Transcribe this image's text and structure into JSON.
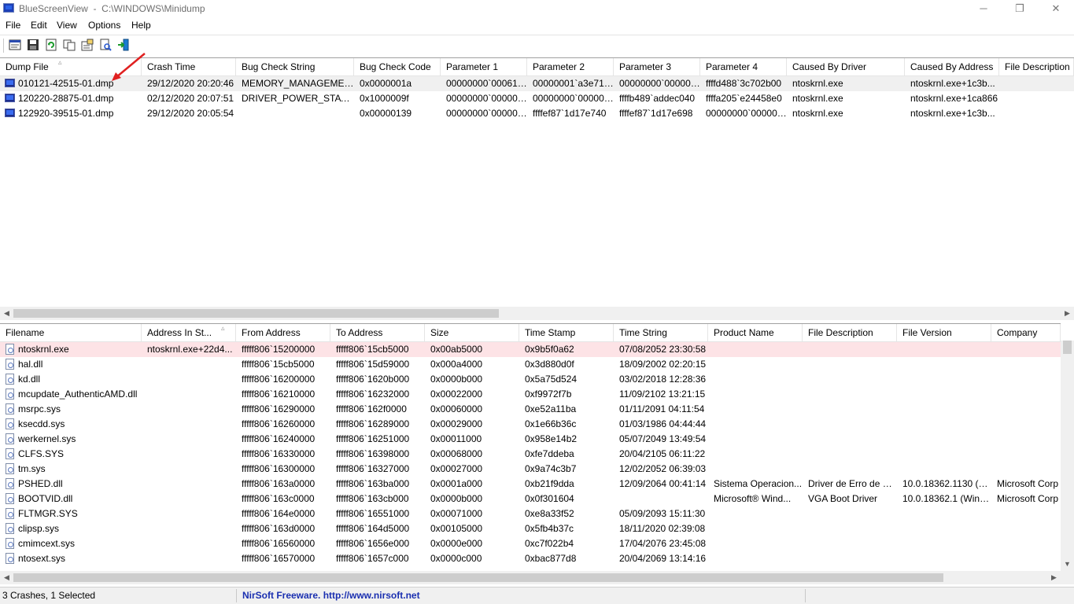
{
  "window": {
    "title": "BlueScreenView  -  C:\\WINDOWS\\Minidump",
    "minimize": "─",
    "restore": "❐",
    "close": "✕"
  },
  "menu": [
    "File",
    "Edit",
    "View",
    "Options",
    "Help"
  ],
  "toolbar": [
    "html-report-icon",
    "save-icon",
    "refresh-icon",
    "copy-icon",
    "properties-icon",
    "find-icon",
    "exit-icon"
  ],
  "dump_list": {
    "columns": [
      "Dump File",
      "Crash Time",
      "Bug Check String",
      "Bug Check Code",
      "Parameter 1",
      "Parameter 2",
      "Parameter 3",
      "Parameter 4",
      "Caused By Driver",
      "Caused By Address",
      "File Description"
    ],
    "sort_indicator": "▵",
    "rows": [
      [
        "010121-42515-01.dmp",
        "29/12/2020 20:20:46",
        "MEMORY_MANAGEMENT",
        "0x0000001a",
        "00000000`000619...",
        "00000001`a3e71fd0",
        "00000000`000000...",
        "ffffd488`3c702b00",
        "ntoskrnl.exe",
        "ntoskrnl.exe+1c3b...",
        ""
      ],
      [
        "120220-28875-01.dmp",
        "02/12/2020 20:07:51",
        "DRIVER_POWER_STATE_F...",
        "0x1000009f",
        "00000000`000000...",
        "00000000`000001...",
        "ffffb489`addec040",
        "ffffa205`e24458e0",
        "ntoskrnl.exe",
        "ntoskrnl.exe+1ca866",
        ""
      ],
      [
        "122920-39515-01.dmp",
        "29/12/2020 20:05:54",
        "",
        "0x00000139",
        "00000000`000000...",
        "ffffef87`1d17e740",
        "ffffef87`1d17e698",
        "00000000`000000...",
        "ntoskrnl.exe",
        "ntoskrnl.exe+1c3b...",
        ""
      ]
    ]
  },
  "driver_list": {
    "columns": [
      "Filename",
      "Address In St...",
      "From Address",
      "To Address",
      "Size",
      "Time Stamp",
      "Time String",
      "Product Name",
      "File Description",
      "File Version",
      "Company"
    ],
    "sort_indicator": "▵",
    "rows": [
      [
        "ntoskrnl.exe",
        "ntoskrnl.exe+22d4...",
        "fffff806`15200000",
        "fffff806`15cb5000",
        "0x00ab5000",
        "0x9b5f0a62",
        "07/08/2052 23:30:58",
        "",
        "",
        "",
        ""
      ],
      [
        "hal.dll",
        "",
        "fffff806`15cb5000",
        "fffff806`15d59000",
        "0x000a4000",
        "0x3d880d0f",
        "18/09/2002 02:20:15",
        "",
        "",
        "",
        ""
      ],
      [
        "kd.dll",
        "",
        "fffff806`16200000",
        "fffff806`1620b000",
        "0x0000b000",
        "0x5a75d524",
        "03/02/2018 12:28:36",
        "",
        "",
        "",
        ""
      ],
      [
        "mcupdate_AuthenticAMD.dll",
        "",
        "fffff806`16210000",
        "fffff806`16232000",
        "0x00022000",
        "0xf9972f7b",
        "11/09/2102 13:21:15",
        "",
        "",
        "",
        ""
      ],
      [
        "msrpc.sys",
        "",
        "fffff806`16290000",
        "fffff806`162f0000",
        "0x00060000",
        "0xe52a11ba",
        "01/11/2091 04:11:54",
        "",
        "",
        "",
        ""
      ],
      [
        "ksecdd.sys",
        "",
        "fffff806`16260000",
        "fffff806`16289000",
        "0x00029000",
        "0x1e66b36c",
        "01/03/1986 04:44:44",
        "",
        "",
        "",
        ""
      ],
      [
        "werkernel.sys",
        "",
        "fffff806`16240000",
        "fffff806`16251000",
        "0x00011000",
        "0x958e14b2",
        "05/07/2049 13:49:54",
        "",
        "",
        "",
        ""
      ],
      [
        "CLFS.SYS",
        "",
        "fffff806`16330000",
        "fffff806`16398000",
        "0x00068000",
        "0xfe7ddeba",
        "20/04/2105 06:11:22",
        "",
        "",
        "",
        ""
      ],
      [
        "tm.sys",
        "",
        "fffff806`16300000",
        "fffff806`16327000",
        "0x00027000",
        "0x9a74c3b7",
        "12/02/2052 06:39:03",
        "",
        "",
        "",
        ""
      ],
      [
        "PSHED.dll",
        "",
        "fffff806`163a0000",
        "fffff806`163ba000",
        "0x0001a000",
        "0xb21f9dda",
        "12/09/2064 00:41:14",
        "Sistema Operacion...",
        "Driver de Erro de H...",
        "10.0.18362.1130 (W...",
        "Microsoft Corp"
      ],
      [
        "BOOTVID.dll",
        "",
        "fffff806`163c0000",
        "fffff806`163cb000",
        "0x0000b000",
        "0x0f301604",
        "",
        "Microsoft® Wind...",
        "VGA Boot Driver",
        "10.0.18362.1 (WinB...",
        "Microsoft Corp"
      ],
      [
        "FLTMGR.SYS",
        "",
        "fffff806`164e0000",
        "fffff806`16551000",
        "0x00071000",
        "0xe8a33f52",
        "05/09/2093 15:11:30",
        "",
        "",
        "",
        ""
      ],
      [
        "clipsp.sys",
        "",
        "fffff806`163d0000",
        "fffff806`164d5000",
        "0x00105000",
        "0x5fb4b37c",
        "18/11/2020 02:39:08",
        "",
        "",
        "",
        ""
      ],
      [
        "cmimcext.sys",
        "",
        "fffff806`16560000",
        "fffff806`1656e000",
        "0x0000e000",
        "0xc7f022b4",
        "17/04/2076 23:45:08",
        "",
        "",
        "",
        ""
      ],
      [
        "ntosext.sys",
        "",
        "fffff806`16570000",
        "fffff806`1657c000",
        "0x0000c000",
        "0xbac877d8",
        "20/04/2069 13:14:16",
        "",
        "",
        "",
        ""
      ]
    ]
  },
  "scroll": {
    "left": "◀",
    "right": "▶",
    "up": "▲",
    "down": "▼"
  },
  "status": {
    "count": "3 Crashes, 1 Selected",
    "credit": "NirSoft Freeware.  http://www.nirsoft.net"
  },
  "colors": {
    "selected_row": "#f0f0f0",
    "highlight_row": "#fde3e6",
    "annotation_arrow": "#e02020",
    "link": "#1a2fb0"
  }
}
